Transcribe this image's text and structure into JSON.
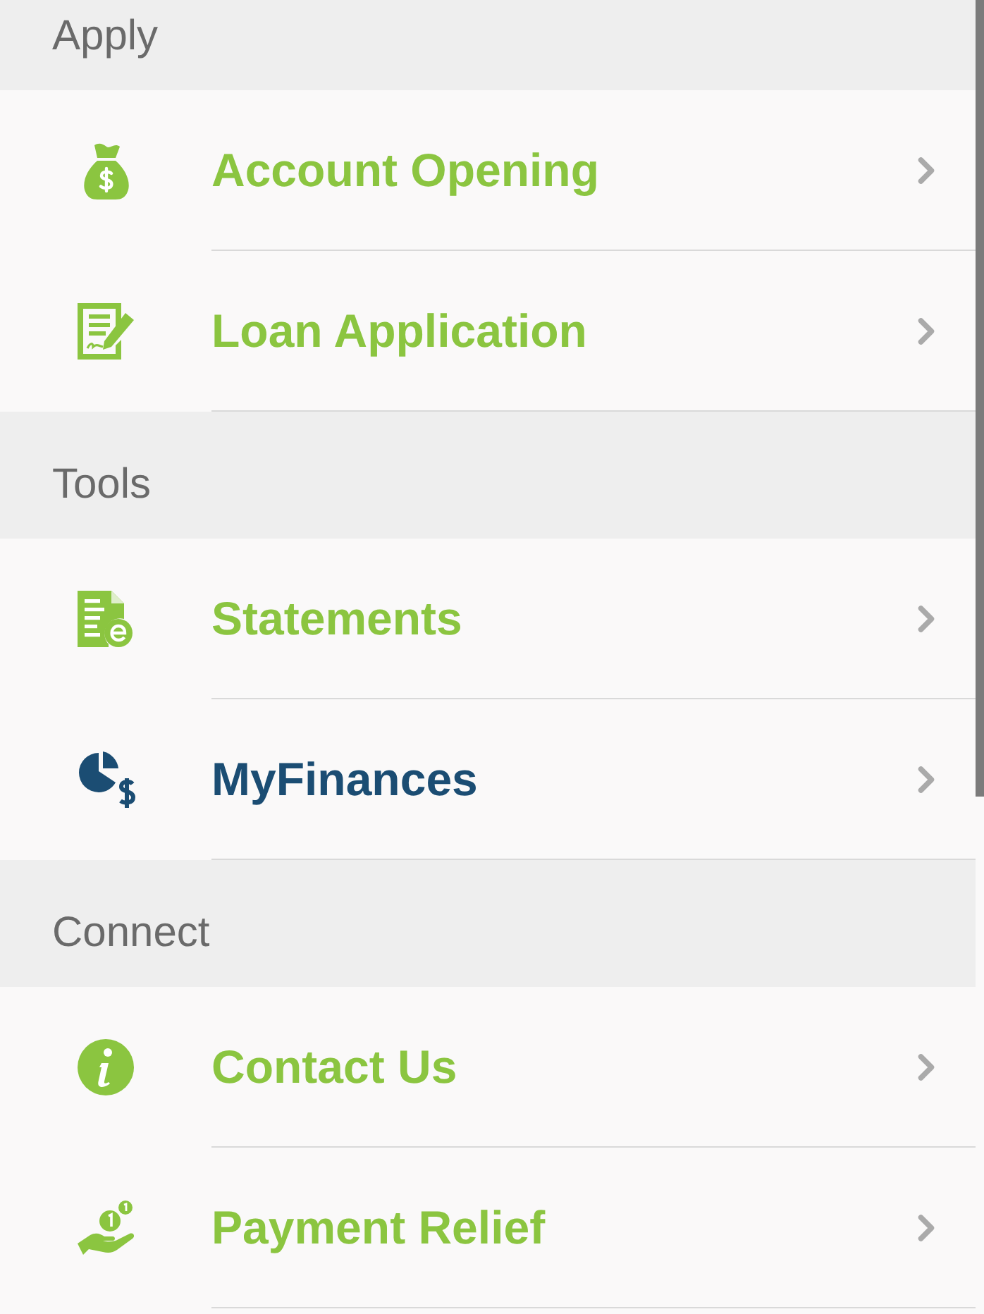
{
  "sections": [
    {
      "title": "Apply",
      "items": [
        {
          "label": "Account Opening",
          "color": "#8bc540"
        },
        {
          "label": "Loan Application",
          "color": "#8bc540"
        }
      ]
    },
    {
      "title": "Tools",
      "items": [
        {
          "label": "Statements",
          "color": "#8bc540"
        },
        {
          "label": "MyFinances",
          "color": "#1b4d73"
        }
      ]
    },
    {
      "title": "Connect",
      "items": [
        {
          "label": "Contact Us",
          "color": "#8bc540"
        },
        {
          "label": "Payment Relief",
          "color": "#8bc540"
        }
      ]
    }
  ]
}
